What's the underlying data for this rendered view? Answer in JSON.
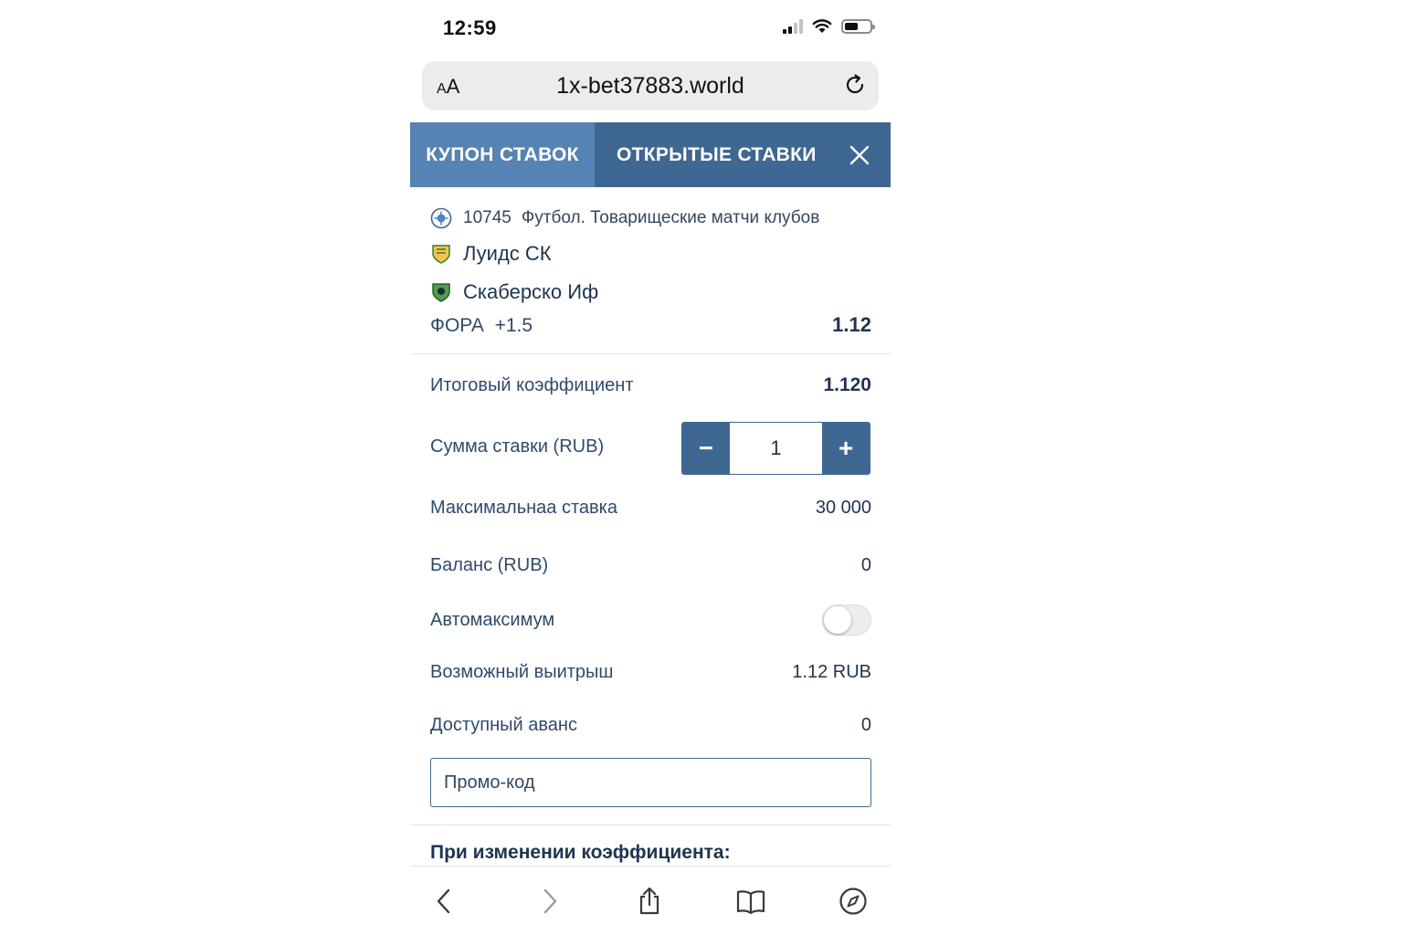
{
  "status_bar": {
    "time": "12:59"
  },
  "url_bar": {
    "text_size_label_small": "A",
    "text_size_label_large": "A",
    "url": "1x-bet37883.world"
  },
  "header": {
    "tab_coupon": "КУПОН СТАВОК",
    "tab_open": "ОТКРЫТЫЕ СТАВКИ"
  },
  "event": {
    "league_id": "10745",
    "league_name": "Футбол. Товарищеские матчи клубов",
    "team_1": "Луидс СК",
    "team_2": "Скаберско Иф",
    "market": "ФОРА  +1.5",
    "odds": "1.12"
  },
  "summary": {
    "total_odds_label": "Итоговый коэффициент",
    "total_odds_value": "1.120",
    "stake_label": "Сумма ставки (RUB)",
    "stake_minus": "−",
    "stake_value": "1",
    "stake_plus": "+",
    "max_stake_label": "Максимальнаа ставка",
    "max_stake_value": "30 000",
    "balance_label": "Баланс (RUB)",
    "balance_value": "0",
    "automax_label": "Автомаксимум",
    "automax_on": false,
    "possible_win_label": "Возможный выитрыш",
    "possible_win_value": "1.12 RUB",
    "advance_label": "Доступный аванс",
    "advance_value": "0",
    "promo_placeholder": "Промо-код"
  },
  "odds_change_label": "При изменении коэффициента:",
  "toolbar": {
    "icons": [
      "chevron-left-icon",
      "chevron-right-icon",
      "share-icon",
      "bookmarks-icon",
      "compass-icon"
    ]
  },
  "colors": {
    "header_dark": "#3e6791",
    "header_light": "#5583b3",
    "text_primary": "#1f3450"
  }
}
